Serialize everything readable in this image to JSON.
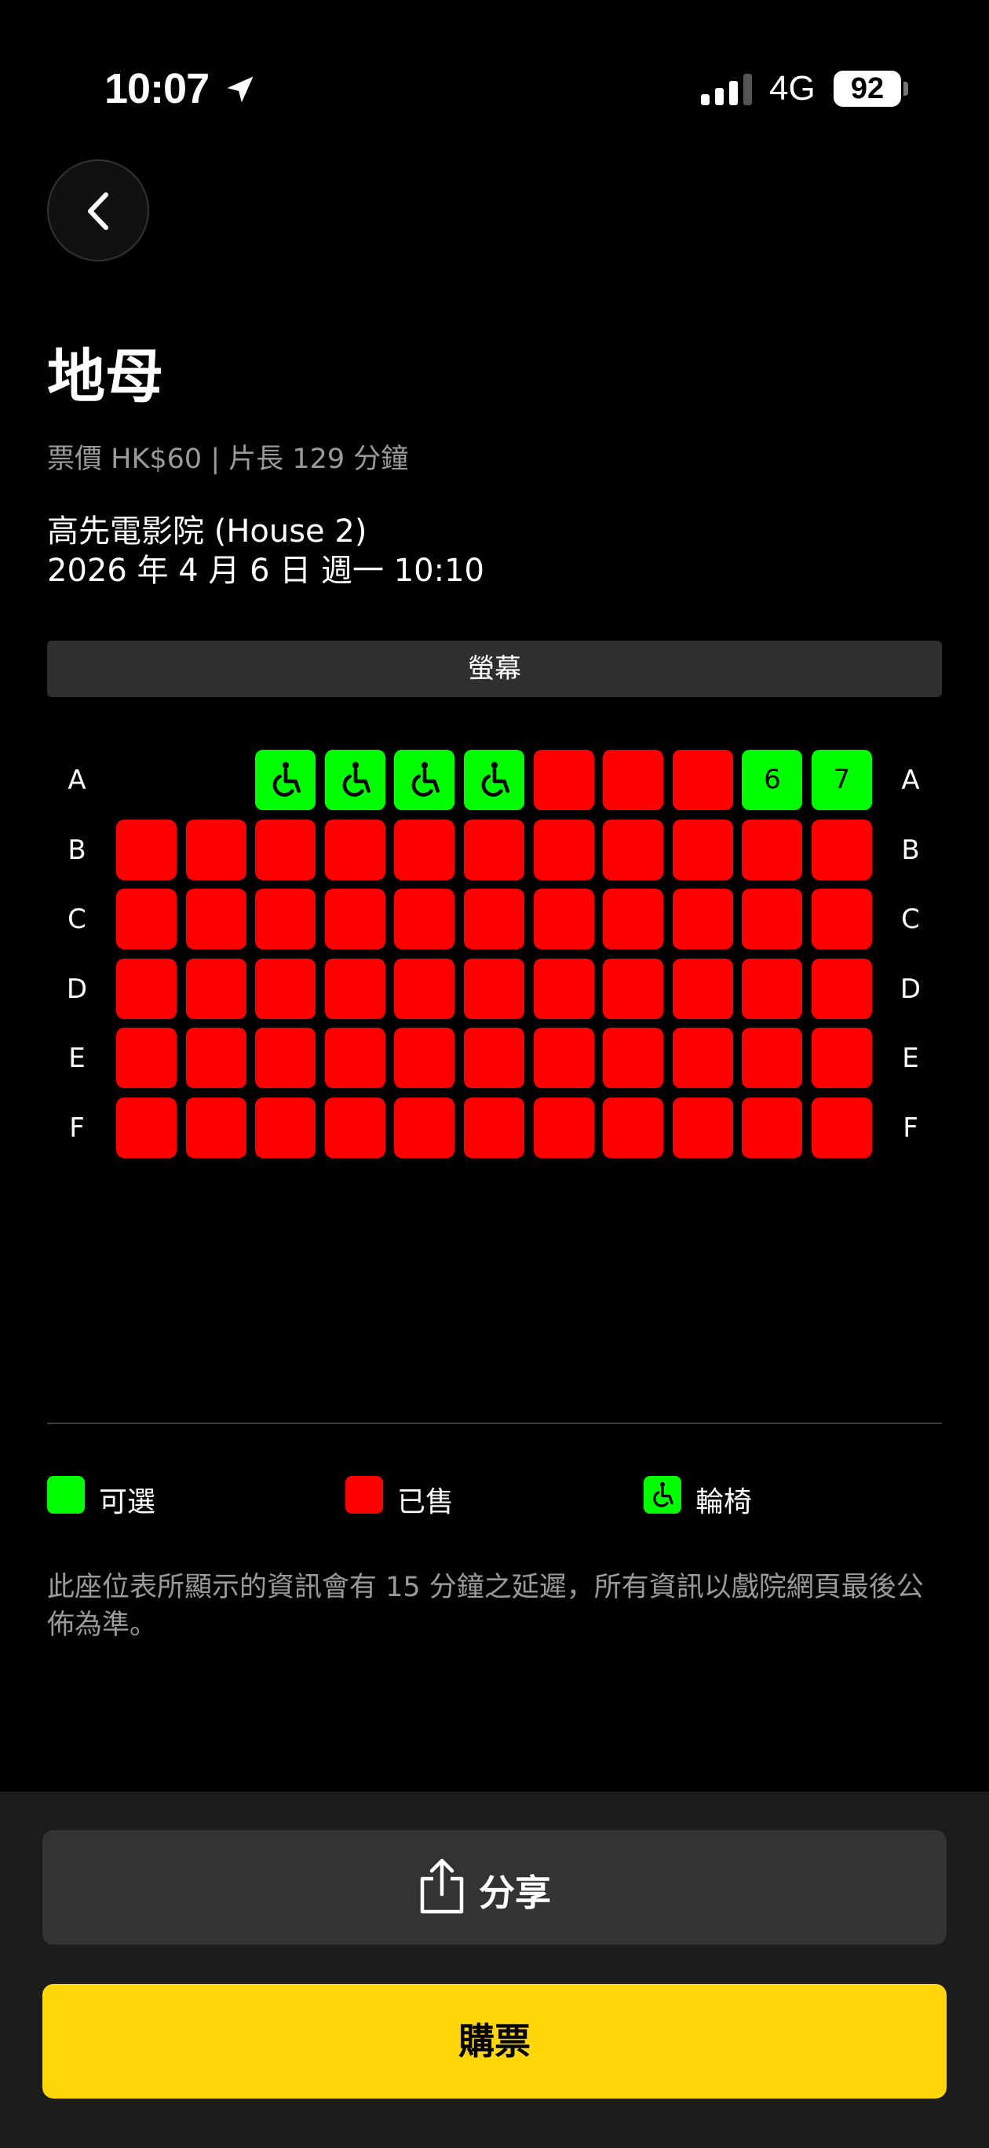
{
  "status_bar": {
    "time": "10:07",
    "network": "4G",
    "battery": "92",
    "icons": [
      "location-arrow-icon",
      "cellular-signal-icon",
      "battery-icon"
    ]
  },
  "nav": {
    "back_icon": "chevron-left-icon"
  },
  "movie": {
    "title": "地母",
    "meta": "票價 HK$60 | 片長 129 分鐘",
    "cinema": "高先電影院 (House 2)",
    "showtime": "2026 年 4 月 6 日 週一 10:10"
  },
  "screen_label": "螢幕",
  "seat_map": {
    "rows": [
      "A",
      "B",
      "C",
      "D",
      "E",
      "F"
    ],
    "seats": {
      "A": [
        null,
        null,
        "wheelchair",
        "wheelchair",
        "wheelchair",
        "wheelchair",
        "sold",
        "sold",
        "sold",
        "available",
        "available"
      ],
      "B": [
        "sold",
        "sold",
        "sold",
        "sold",
        "sold",
        "sold",
        "sold",
        "sold",
        "sold",
        "sold",
        "sold"
      ],
      "C": [
        "sold",
        "sold",
        "sold",
        "sold",
        "sold",
        "sold",
        "sold",
        "sold",
        "sold",
        "sold",
        "sold"
      ],
      "D": [
        "sold",
        "sold",
        "sold",
        "sold",
        "sold",
        "sold",
        "sold",
        "sold",
        "sold",
        "sold",
        "sold"
      ],
      "E": [
        "sold",
        "sold",
        "sold",
        "sold",
        "sold",
        "sold",
        "sold",
        "sold",
        "sold",
        "sold",
        "sold"
      ],
      "F": [
        "sold",
        "sold",
        "sold",
        "sold",
        "sold",
        "sold",
        "sold",
        "sold",
        "sold",
        "sold",
        "sold"
      ]
    },
    "seat_numbers": {
      "A": [
        null,
        null,
        null,
        null,
        null,
        null,
        null,
        null,
        null,
        "6",
        "7"
      ]
    },
    "colors": {
      "available": "#00ff00",
      "sold": "#ff0000"
    }
  },
  "legend": {
    "available": "可選",
    "sold": "已售",
    "wheelchair": "輪椅"
  },
  "disclaimer": "此座位表所顯示的資訊會有 15 分鐘之延遲，所有資訊以戲院網頁最後公佈為準。",
  "actions": {
    "share_label": "分享",
    "share_icon": "share-icon",
    "buy_label": "購票",
    "buy_color": "#ffd60a"
  }
}
